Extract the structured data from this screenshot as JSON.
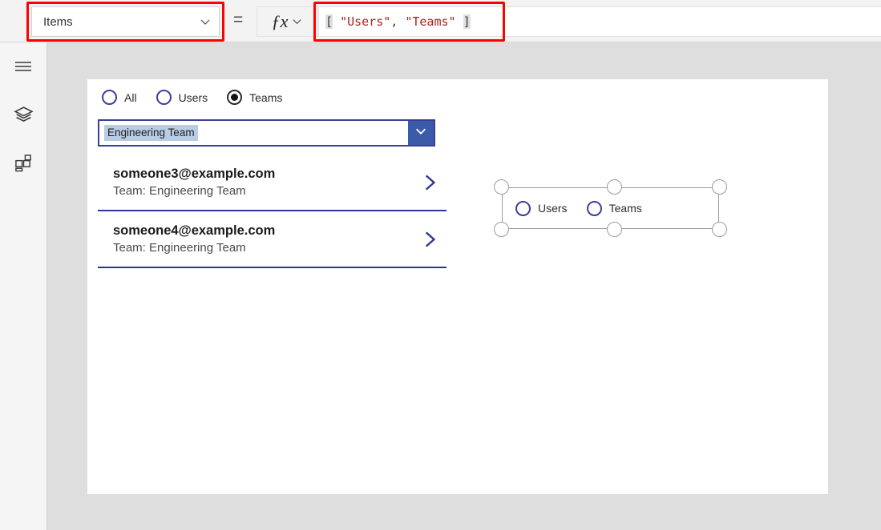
{
  "toolbar": {
    "property_dropdown": {
      "value": "Items",
      "chevron_icon": "chevron-down-icon"
    },
    "equals_sign": "=",
    "fx": {
      "glyph": "ƒx",
      "chevron_icon": "chevron-down-icon"
    },
    "formula": {
      "open_bracket": "[",
      "item1": "\"Users\"",
      "comma": ", ",
      "item2": "\"Teams\"",
      "close_bracket": "]",
      "full_text": "[ \"Users\", \"Teams\" ]"
    }
  },
  "annotations": {
    "property_box_color": "#fe0000",
    "formula_box_color": "#fe0000"
  },
  "sidebar": {
    "items": [
      {
        "name": "hamburger-menu-icon",
        "label": "Menu"
      },
      {
        "name": "tree-view-icon",
        "label": "Tree view"
      },
      {
        "name": "insert-components-icon",
        "label": "Insert"
      }
    ]
  },
  "canvas": {
    "radio_group": {
      "options": [
        {
          "label": "All",
          "selected": false
        },
        {
          "label": "Users",
          "selected": false
        },
        {
          "label": "Teams",
          "selected": true
        }
      ]
    },
    "dropdown": {
      "value": "Engineering Team",
      "chevron_icon": "chevron-down-icon"
    },
    "gallery": {
      "items": [
        {
          "title": "someone3@example.com",
          "subtitle": "Team: Engineering Team",
          "chevron_icon": "chevron-right-icon"
        },
        {
          "title": "someone4@example.com",
          "subtitle": "Team: Engineering Team",
          "chevron_icon": "chevron-right-icon"
        }
      ]
    },
    "selected_control": {
      "options": [
        {
          "label": "Users",
          "selected": false
        },
        {
          "label": "Teams",
          "selected": false
        }
      ],
      "handles": [
        "top-left",
        "top-middle",
        "top-right",
        "bottom-left",
        "bottom-middle",
        "bottom-right"
      ]
    }
  },
  "colors": {
    "accent_blue": "#3b5ba8",
    "control_border": "#3b3f9c",
    "separator": "#2f3592",
    "string_literal": "#b02020",
    "annotation_red": "#fe0000",
    "selection_highlight": "#b8cce4",
    "workspace_bg": "#dedede"
  }
}
